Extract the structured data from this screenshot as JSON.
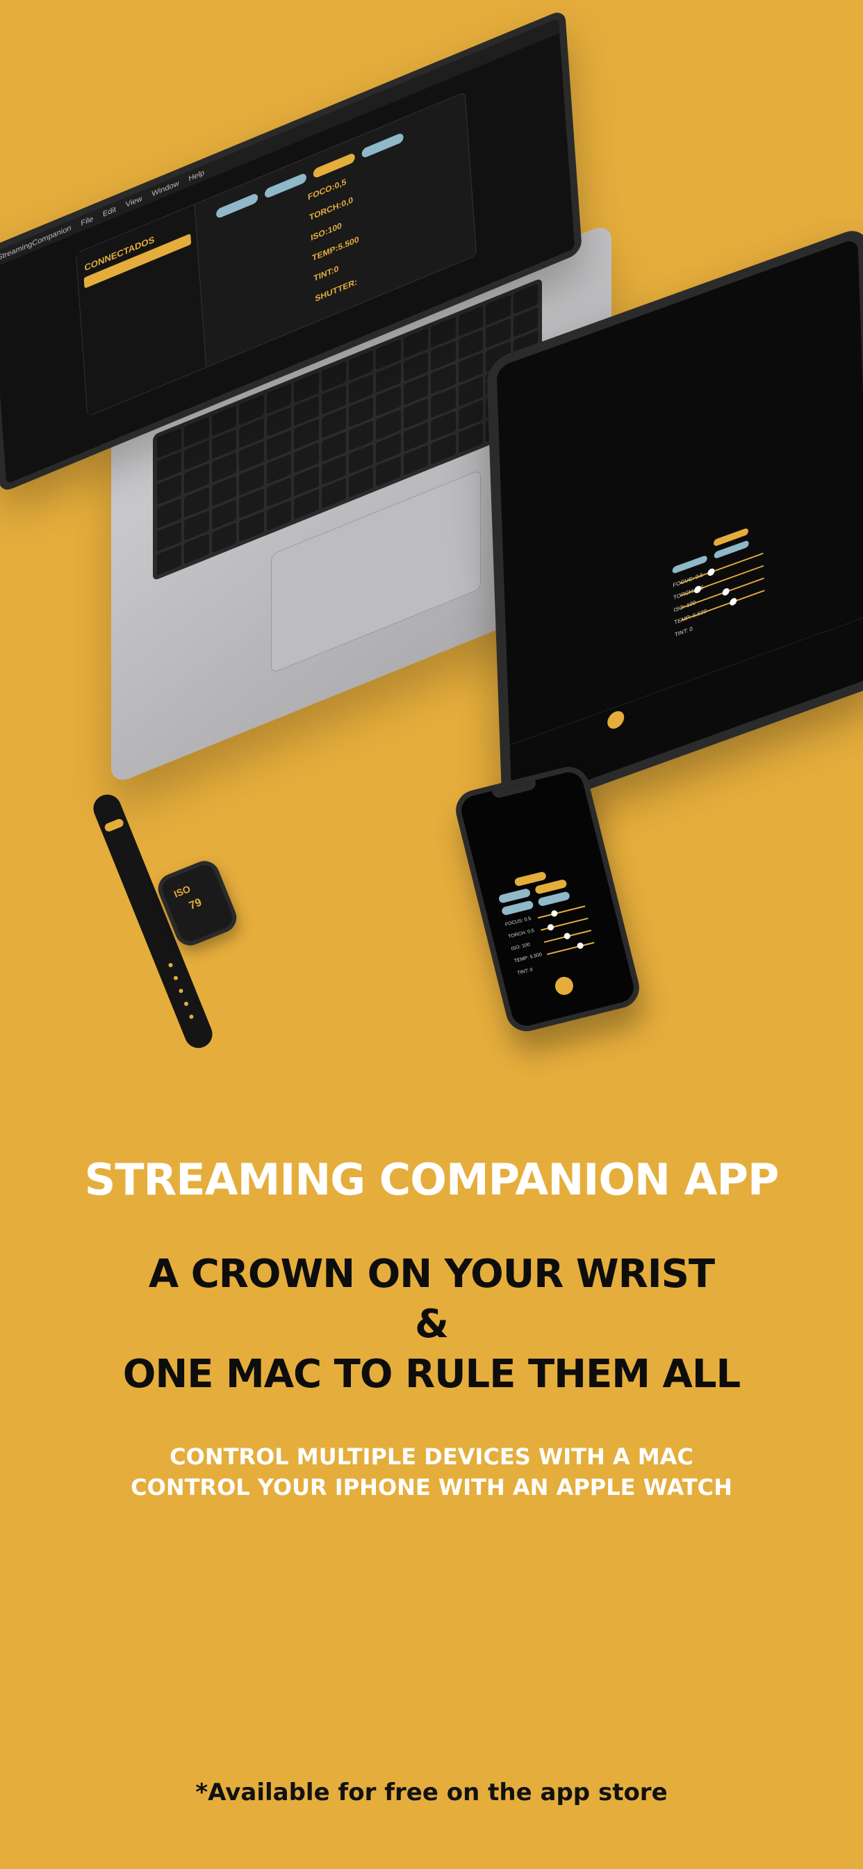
{
  "background_color": "#E5AD3C",
  "accent_color": "#E5AD3C",
  "pill_color": "#8FB8C8",
  "laptop": {
    "menubar": [
      "StreamingCompanion",
      "File",
      "Edit",
      "View",
      "Window",
      "Help"
    ],
    "sidebar_title": "CONNECTADOS",
    "params": [
      "FOCO:0,5",
      "TORCH:0,0",
      "ISO:100",
      "TEMP:5.500",
      "TINT:0",
      "SHUTTER:"
    ],
    "model": "MacBook Pro"
  },
  "tablet": {
    "labels": [
      "FOCUS: 0.5",
      "TORCH: 0.5",
      "ISO: 100",
      "TEMP: 5.500",
      "TINT: 0"
    ]
  },
  "phone": {
    "labels": [
      "FOCUS: 0.5",
      "TORCH: 0.5",
      "ISO: 100",
      "TEMP: 5.500",
      "TINT: 0"
    ]
  },
  "watch": {
    "label": "ISO",
    "value": "79"
  },
  "text": {
    "headline": "STREAMING COMPANION APP",
    "tagline_1": "A CROWN ON YOUR WRIST",
    "tagline_2": "&",
    "tagline_3": "ONE MAC TO RULE THEM ALL",
    "sub_1": "CONTROL MULTIPLE DEVICES WITH A MAC",
    "sub_2": "CONTROL YOUR IPHONE WITH AN APPLE WATCH",
    "footer": "*Available for free on the app store"
  }
}
